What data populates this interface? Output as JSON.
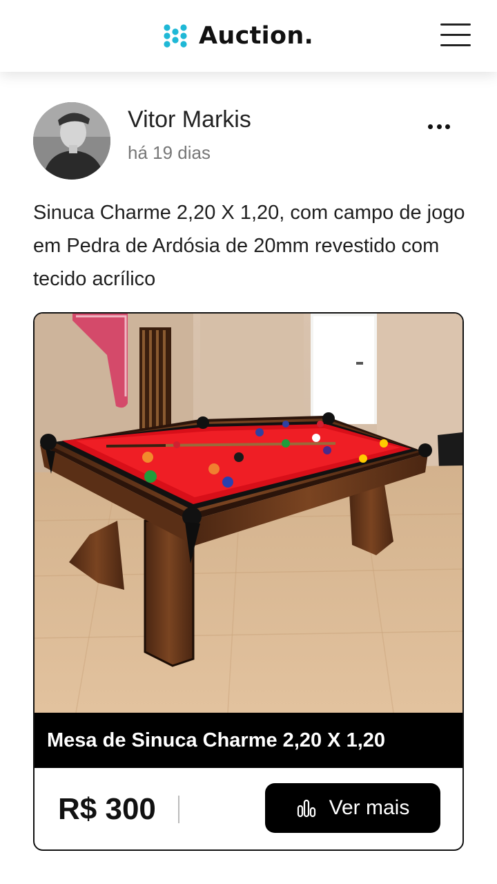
{
  "header": {
    "brand_name": "Auction.",
    "logo_icon": "dots-logo-icon",
    "logo_color": "#1fb8d6",
    "menu_icon": "hamburger-menu-icon"
  },
  "post": {
    "author_name": "Vitor Markis",
    "time_ago": "há 19 dias",
    "more_icon": "more-horizontal-icon",
    "text": "Sinuca Charme 2,20 X 1,20, com campo de jogo em Pedra de Ardósia de 20mm revestido com tecido acrílico"
  },
  "card": {
    "photo_subject": "red-felt pool table on wooden floor",
    "title": "Mesa de Sinuca Charme 2,20 X 1,20",
    "price": "R$ 300",
    "button_label": "Ver mais",
    "button_icon": "bar-chart-icon",
    "accent_colors": {
      "felt": "#e8101c",
      "wood": "#6b3a1c",
      "title_bar": "#000000"
    }
  }
}
